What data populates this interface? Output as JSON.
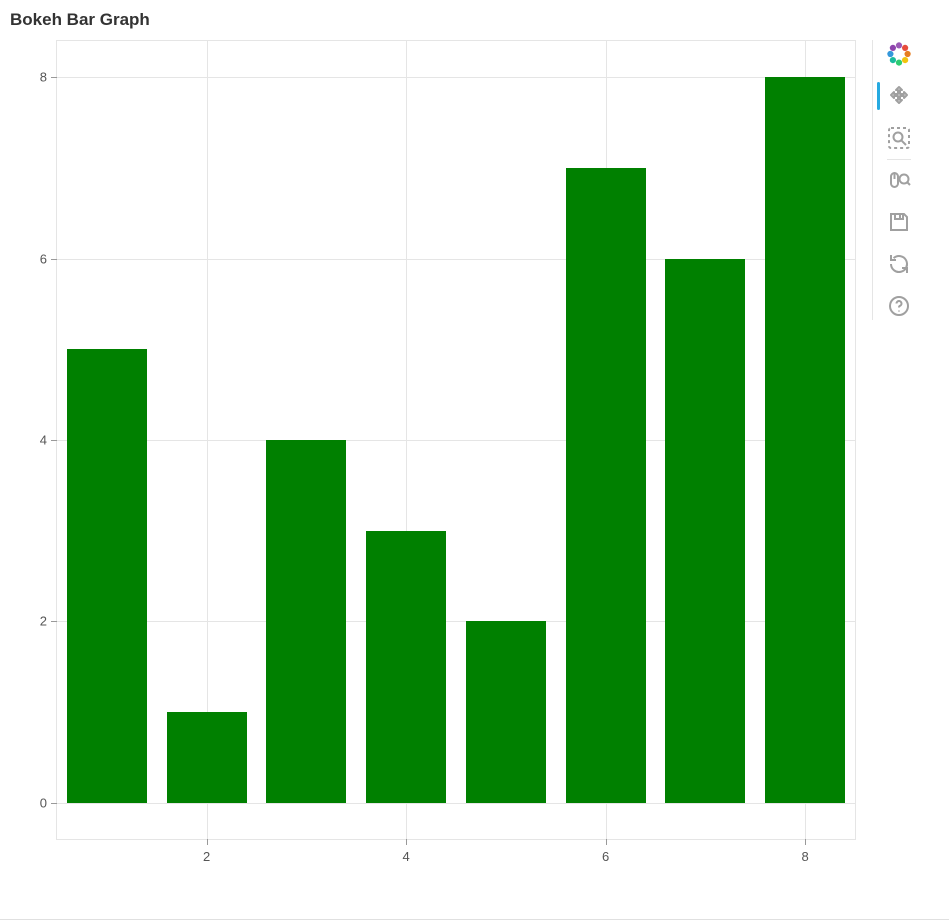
{
  "chart_data": {
    "type": "bar",
    "title": "Bokeh Bar Graph",
    "x": [
      1,
      2,
      3,
      4,
      5,
      6,
      7,
      8
    ],
    "values": [
      5,
      1,
      4,
      3,
      2,
      7,
      6,
      8
    ],
    "bar_color": "#008000",
    "xlabel": "",
    "ylabel": "",
    "x_range": [
      0.5,
      8.5
    ],
    "y_range": [
      -0.4,
      8.4
    ],
    "x_ticks": [
      2,
      4,
      6,
      8
    ],
    "y_ticks": [
      0,
      2,
      4,
      6,
      8
    ],
    "bar_width": 0.8
  },
  "toolbar": {
    "logo": "bokeh-logo",
    "tools": [
      {
        "id": "pan",
        "label": "Pan",
        "active": true
      },
      {
        "id": "box-zoom",
        "label": "Box Zoom",
        "active": false
      },
      {
        "id": "wheel-zoom",
        "label": "Wheel Zoom",
        "active": false
      },
      {
        "id": "save",
        "label": "Save",
        "active": false
      },
      {
        "id": "reset",
        "label": "Reset",
        "active": false
      },
      {
        "id": "help",
        "label": "Help",
        "active": false
      }
    ]
  }
}
